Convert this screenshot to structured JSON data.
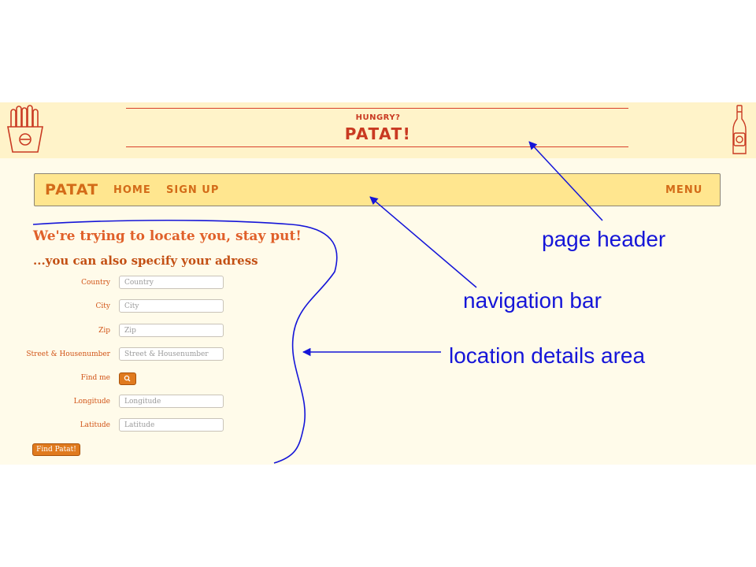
{
  "header": {
    "kicker": "HUNGRY?",
    "brand": "PATAT!"
  },
  "navbar": {
    "brand": "PATAT",
    "links": {
      "home": "HOME",
      "signup": "SIGN UP",
      "menu": "MENU"
    }
  },
  "location": {
    "heading": "We're trying to locate you, stay put!",
    "subheading": "...you can also specify your adress",
    "fields": {
      "country": {
        "label": "Country",
        "placeholder": "Country"
      },
      "city": {
        "label": "City",
        "placeholder": "City"
      },
      "zip": {
        "label": "Zip",
        "placeholder": "Zip"
      },
      "street": {
        "label": "Street & Housenumber",
        "placeholder": "Street & Housenumber"
      },
      "longitude": {
        "label": "Longitude",
        "placeholder": "Longitude"
      },
      "latitude": {
        "label": "Latitude",
        "placeholder": "Latitude"
      }
    },
    "find_me": {
      "label": "Find me",
      "icon": "search-icon"
    },
    "submit_label": "Find Patat!"
  },
  "annotations": {
    "page_header": "page header",
    "navigation_bar": "navigation bar",
    "location_details": "location details area"
  },
  "colors": {
    "accent_red": "#c93a22",
    "accent_orange": "#d36b18",
    "nav_bg": "#ffe68f",
    "header_bg": "#fff3c9",
    "page_bg": "#fffbea",
    "button": "#e07a1e",
    "annotation_blue": "#1515d8"
  }
}
